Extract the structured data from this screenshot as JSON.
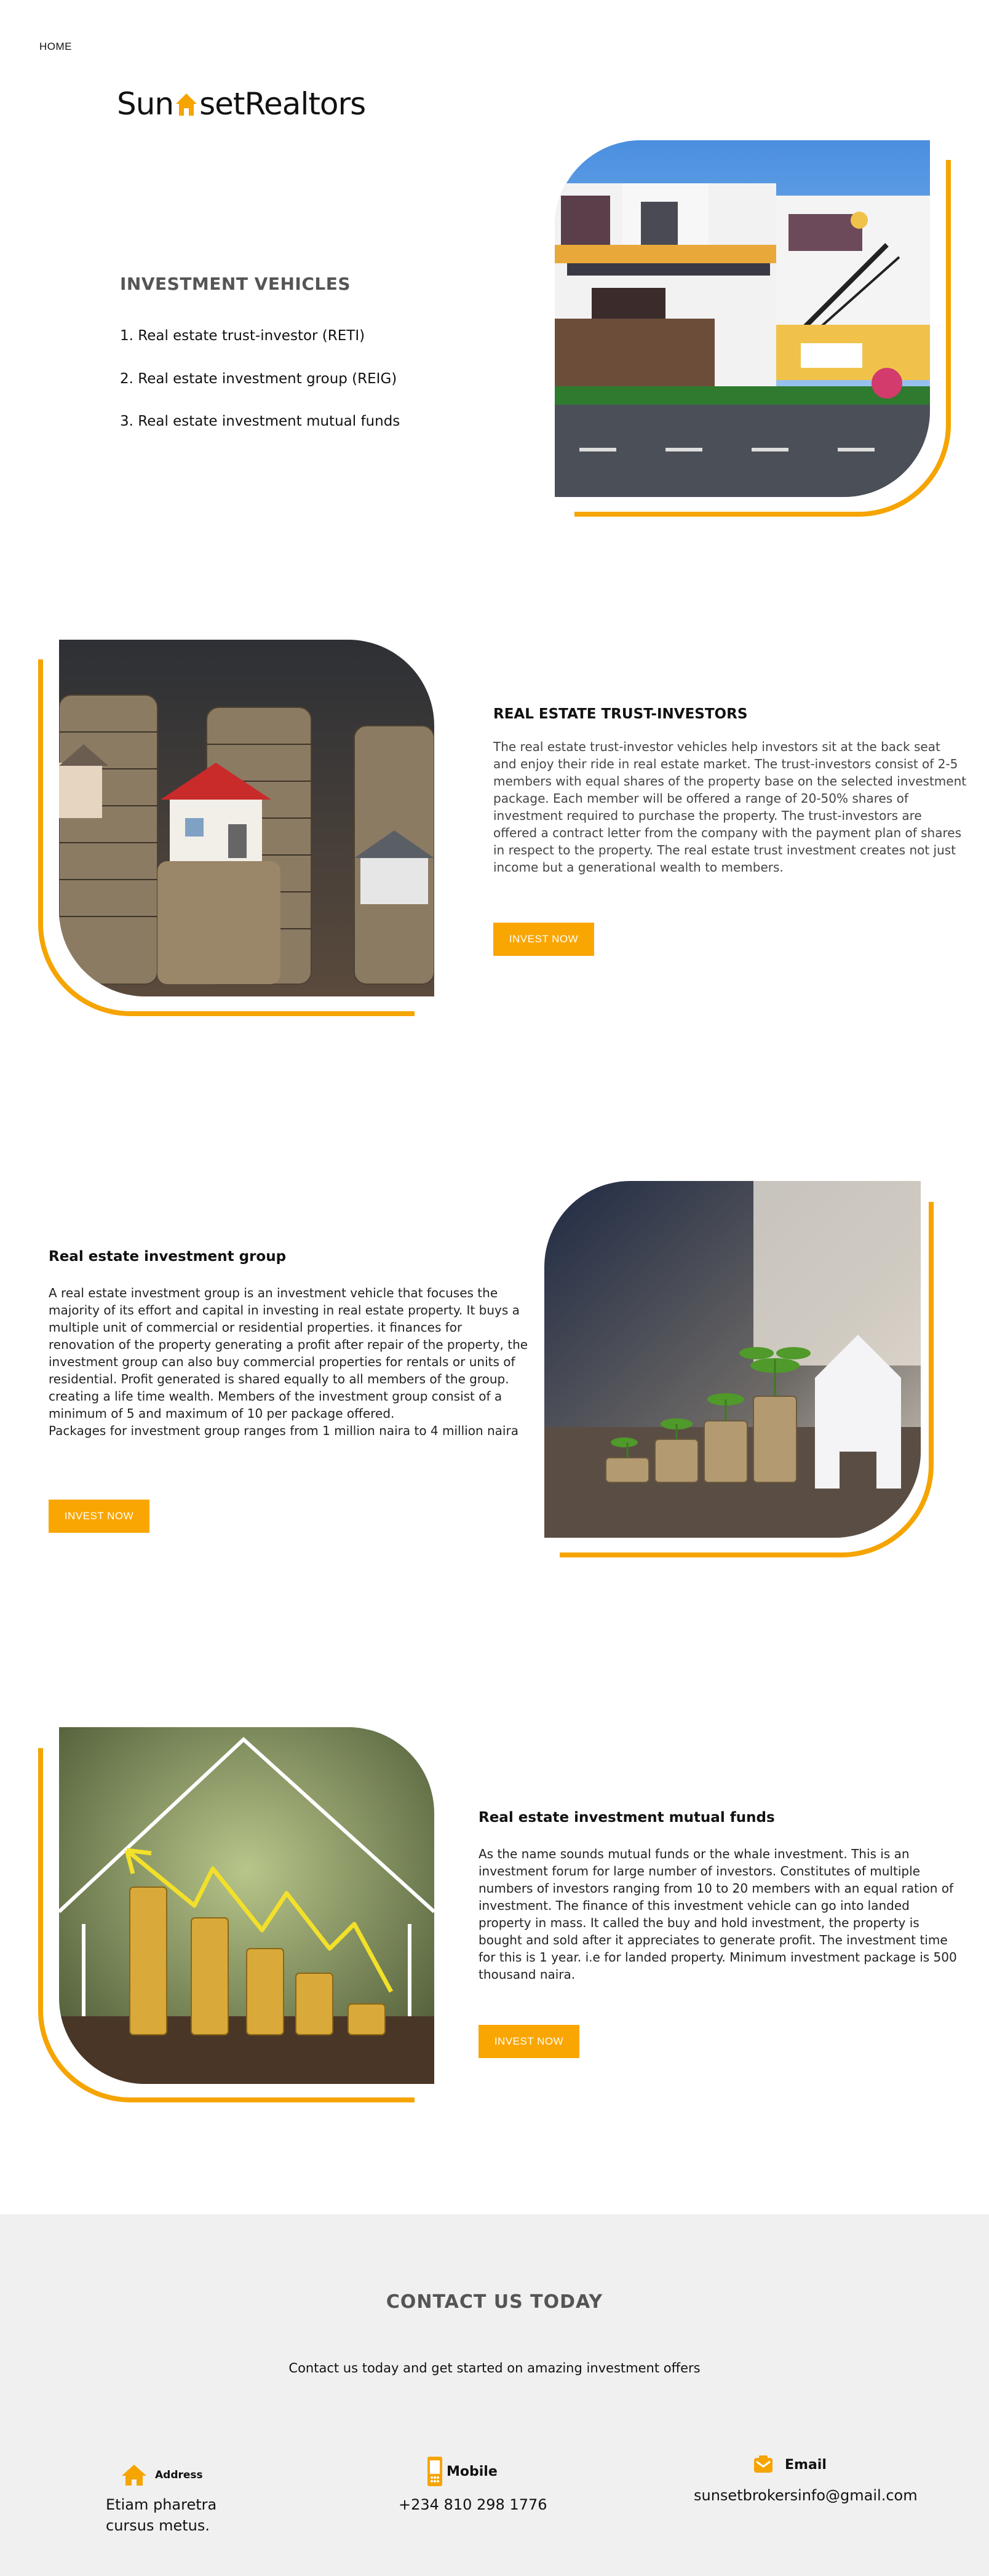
{
  "nav": {
    "home": "HOME"
  },
  "brand": {
    "part1": "Sun",
    "part2": "setRealtors",
    "accent": "#f5a400"
  },
  "intro": {
    "title": "INVESTMENT VEHICLES",
    "items": [
      "1. Real estate trust-investor (RETI)",
      "2. Real estate investment group (REIG)",
      "3. Real estate investment mutual funds"
    ]
  },
  "sections": [
    {
      "title": "REAL ESTATE TRUST-INVESTORS",
      "body": "The real estate trust-investor vehicles help investors sit at the back seat and enjoy their ride in real estate market. The trust-investors consist of 2-5 members with equal shares of the property base on the selected investment package. Each member will be offered a range of 20-50% shares of investment required to purchase the property. The trust-investors are offered a contract letter from the company with the payment plan of shares in respect to the property. The real estate trust investment creates not just income but a generational wealth to members.",
      "button": "INVEST NOW"
    },
    {
      "title": "Real estate investment group",
      "body": " A real estate investment group is an investment vehicle that focuses the majority of its effort and capital in investing in real estate property. It buys a multiple unit of commercial or residential properties. it finances for renovation of the property generating a profit after repair of the property, the investment group can also buy commercial properties for rentals or units of residential. Profit generated is shared equally to all members of the group. creating a life time wealth.  Members of the investment group consist of a minimum of 5 and maximum of 10 per package offered.\nPackages for investment group ranges from 1 million naira to 4 million naira",
      "button": "INVEST NOW"
    },
    {
      "title": "Real estate investment mutual funds",
      "body": " As the name sounds mutual funds or the whale investment. This is an investment forum for large number of investors. Constitutes of multiple numbers of investors ranging from 10 to 20  members with an equal ration of investment. The finance of this investment vehicle can go into landed property in mass. It called the buy and hold investment, the property is bought and sold after it appreciates to generate profit. The investment time for this is 1 year. i.e for landed property. Minimum investment package is 500 thousand naira.",
      "button": "INVEST NOW"
    }
  ],
  "contact": {
    "title": "CONTACT US TODAY",
    "subtitle": "Contact us today and get started on amazing investment offers",
    "address_label": "Address",
    "address_value": "Etiam pharetra cursus metus.",
    "mobile_label": "Mobile",
    "mobile_value": "+234 810 298 1776",
    "email_label": "Email",
    "email_value": "sunsetbrokersinfo@gmail.com",
    "icon_color": "#f5a400"
  }
}
